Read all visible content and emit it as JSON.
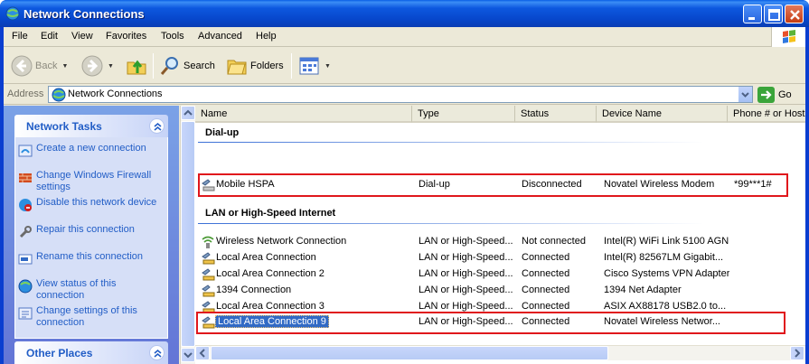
{
  "window": {
    "title": "Network Connections"
  },
  "menu": [
    "File",
    "Edit",
    "View",
    "Favorites",
    "Tools",
    "Advanced",
    "Help"
  ],
  "toolbar": {
    "back": "Back",
    "search": "Search",
    "folders": "Folders"
  },
  "address": {
    "label": "Address",
    "value": "Network Connections",
    "go": "Go"
  },
  "network_tasks": {
    "title": "Network Tasks",
    "items": [
      {
        "label": "Create a new connection",
        "icon": "new-connection-icon"
      },
      {
        "label": "Change Windows Firewall settings",
        "icon": "firewall-icon"
      },
      {
        "label": "Disable this network device",
        "icon": "disable-device-icon"
      },
      {
        "label": "Repair this connection",
        "icon": "repair-icon"
      },
      {
        "label": "Rename this connection",
        "icon": "rename-icon"
      },
      {
        "label": "View status of this connection",
        "icon": "status-icon"
      },
      {
        "label": "Change settings of this connection",
        "icon": "settings-icon"
      }
    ]
  },
  "other_places": {
    "title": "Other Places"
  },
  "columns": [
    "Name",
    "Type",
    "Status",
    "Device Name",
    "Phone # or Host"
  ],
  "groups": {
    "dialup": {
      "title": "Dial-up",
      "rows": [
        {
          "name": "Mobile HSPA",
          "type": "Dial-up",
          "status": "Disconnected",
          "device": "Novatel Wireless Modem",
          "phone": "*99***1#"
        }
      ]
    },
    "lan": {
      "title": "LAN or High-Speed Internet",
      "rows": [
        {
          "name": "Wireless Network Connection",
          "type": "LAN or High-Speed...",
          "status": "Not connected",
          "device": "Intel(R) WiFi Link 5100 AGN",
          "phone": ""
        },
        {
          "name": "Local Area Connection",
          "type": "LAN or High-Speed...",
          "status": "Connected",
          "device": "Intel(R) 82567LM Gigabit...",
          "phone": ""
        },
        {
          "name": "Local Area Connection 2",
          "type": "LAN or High-Speed...",
          "status": "Connected",
          "device": "Cisco Systems VPN Adapter",
          "phone": ""
        },
        {
          "name": "1394 Connection",
          "type": "LAN or High-Speed...",
          "status": "Connected",
          "device": "1394 Net Adapter",
          "phone": ""
        },
        {
          "name": "Local Area Connection 3",
          "type": "LAN or High-Speed...",
          "status": "Connected",
          "device": "ASIX AX88178 USB2.0 to...",
          "phone": ""
        },
        {
          "name": "Local Area Connection 9",
          "type": "LAN or High-Speed...",
          "status": "Connected",
          "device": "Novatel Wireless Networ...",
          "phone": ""
        }
      ]
    }
  },
  "colors": {
    "title_blue": "#0a5fe6",
    "task_link": "#215dc6",
    "selection": "#316ac5",
    "highlight_box": "#e0171c"
  }
}
